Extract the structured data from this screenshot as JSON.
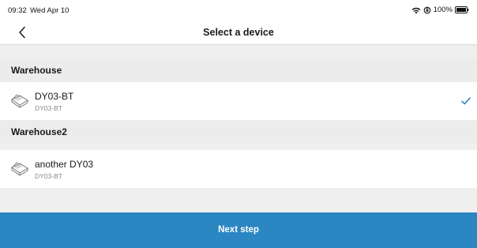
{
  "status_bar": {
    "time": "09:32",
    "date": "Wed Apr 10",
    "battery": "100%",
    "icons": [
      "wifi-icon",
      "orientation-lock-icon",
      "battery-icon"
    ]
  },
  "nav": {
    "back_icon": "chevron-left-icon",
    "title": "Select a device"
  },
  "sections": [
    {
      "header": "Warehouse",
      "devices": [
        {
          "name": "DY03-BT",
          "model": "DY03-BT",
          "selected": true,
          "icon": "printer-icon"
        }
      ]
    },
    {
      "header": "Warehouse2",
      "devices": [
        {
          "name": "another DY03",
          "model": "DY03-BT",
          "selected": false,
          "icon": "printer-icon"
        }
      ]
    }
  ],
  "footer": {
    "next_label": "Next step"
  },
  "colors": {
    "accent": "#2c86c2",
    "background": "#efefef",
    "check": "#2c86c2"
  }
}
